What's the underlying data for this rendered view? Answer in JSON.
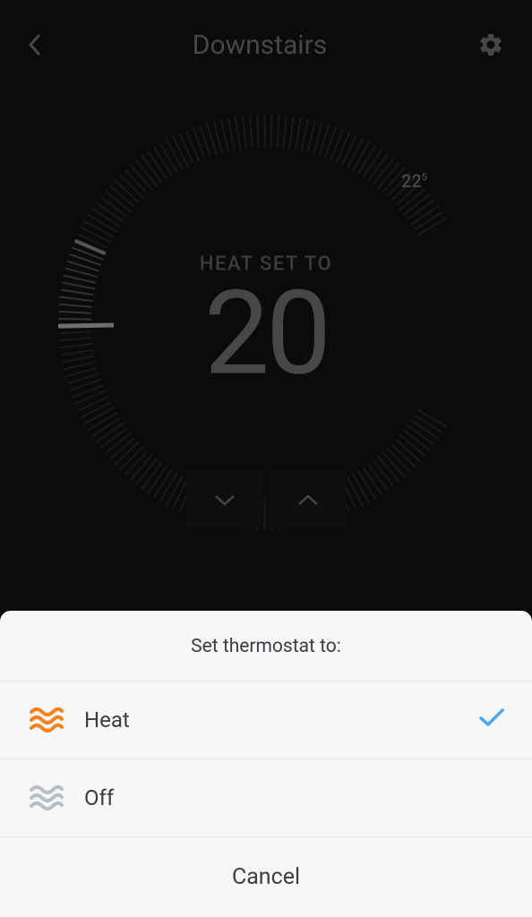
{
  "header": {
    "title": "Downstairs"
  },
  "dial": {
    "heat_label": "HEAT SET TO",
    "set_temp": "20",
    "current_temp": "22",
    "current_temp_decimal": "5"
  },
  "modal": {
    "title": "Set thermostat to:",
    "options": [
      {
        "label": "Heat",
        "selected": true
      },
      {
        "label": "Off",
        "selected": false
      }
    ],
    "cancel_label": "Cancel"
  },
  "colors": {
    "heat_icon": "#f58220",
    "off_icon": "#b9bec3",
    "check": "#4aa9e8"
  }
}
